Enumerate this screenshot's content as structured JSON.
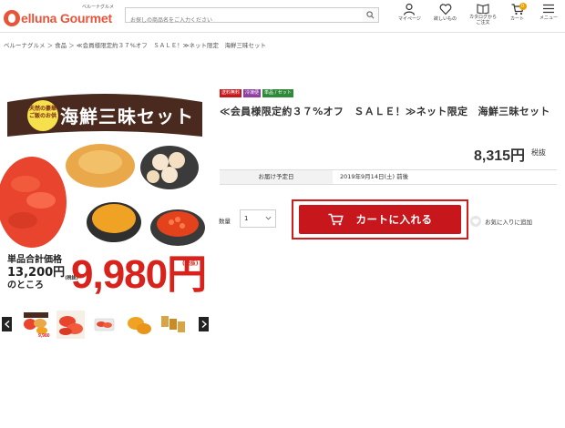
{
  "header": {
    "logo_sub": "ベルーナグルメ",
    "logo_text_a": "elluna",
    "logo_text_b": "Gourmet",
    "search_placeholder": "お探しの商品名をご入力ください",
    "nav": [
      {
        "label": "マイページ",
        "icon": "user-icon"
      },
      {
        "label": "欲しいもの",
        "icon": "heart-icon"
      },
      {
        "label": "カタログから\nご注文",
        "icon": "catalog-icon"
      },
      {
        "label": "カート",
        "icon": "cart-icon",
        "badge": "0"
      },
      {
        "label": "メニュー",
        "icon": "menu-icon"
      }
    ]
  },
  "breadcrumb": "ベルーナグルメ ＞ 食品 ＞ ≪会員様限定約３７%オフ　ＳＡＬＥ！≫ネット限定　海鮮三昧セット",
  "main_image": {
    "title": "海鮮三昧セット",
    "tag": "天然の豪華ご飯のお供",
    "label1": "単品合計価格",
    "price_small": "13,200",
    "price_small_suffix": "円",
    "tax_note_small": "(税抜)",
    "label2": "のところ",
    "big_price": "9,980",
    "big_price_suffix": "円",
    "tax_note": "(税抜)"
  },
  "thumbnails": [
    {
      "label": "thumbnail-set"
    },
    {
      "label": "thumbnail-mentaiko"
    },
    {
      "label": "thumbnail-mentaiko-pack"
    },
    {
      "label": "thumbnail-uni"
    },
    {
      "label": "thumbnail-packs"
    }
  ],
  "product": {
    "badges": [
      {
        "text": "送料無料",
        "color": "#c8161d"
      },
      {
        "text": "冷凍便",
        "color": "#8e3fa1"
      },
      {
        "text": "単品 / セット",
        "color": "#2f8a3a"
      }
    ],
    "title": "≪会員様限定約３７%オフ　ＳＡＬＥ！≫ネット限定　海鮮三昧セット",
    "price": "8,315円",
    "price_tax": "税抜",
    "delivery_label": "お届け予定日",
    "delivery_value": "2019年9月14日(土) 前後",
    "qty_label": "数量",
    "qty_value": "1",
    "cart_button": "カートに入れる",
    "favorite": "お気に入りに追加"
  },
  "colors": {
    "brand": "#e8543a",
    "accent": "#c8161d",
    "price_red": "#d8221c"
  }
}
